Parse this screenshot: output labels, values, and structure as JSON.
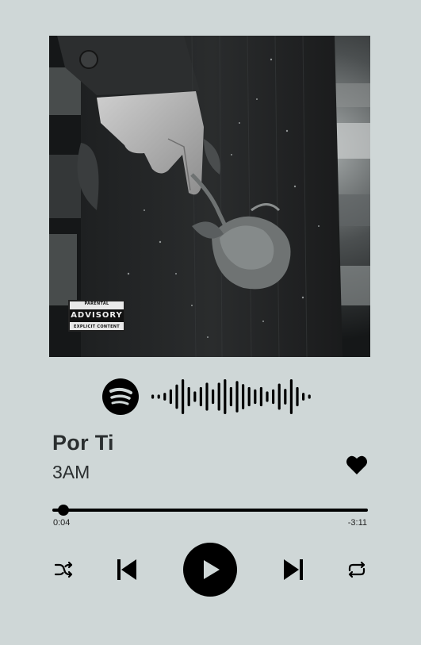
{
  "album": {
    "advisory_top": "PARENTAL",
    "advisory_main": "ADVISORY",
    "advisory_bottom": "EXPLICIT CONTENT"
  },
  "spotify_code": {
    "logo_icon": "spotify-logo-icon",
    "bar_levels": [
      0.12,
      0.12,
      0.22,
      0.42,
      0.7,
      1.0,
      0.55,
      0.3,
      0.55,
      0.8,
      0.42,
      0.8,
      1.0,
      0.55,
      0.9,
      0.72,
      0.55,
      0.42,
      0.55,
      0.3,
      0.42,
      0.75,
      0.45,
      1.0,
      0.55,
      0.22,
      0.12
    ]
  },
  "track": {
    "title": "Por Ti",
    "artist": "3AM",
    "liked": true
  },
  "playback": {
    "elapsed": "0:04",
    "remaining": "-3:11",
    "progress_fraction": 0.035
  },
  "controls": {
    "shuffle_icon": "shuffle-icon",
    "previous_icon": "skip-previous-icon",
    "play_icon": "play-icon",
    "next_icon": "skip-next-icon",
    "repeat_icon": "repeat-icon"
  },
  "colors": {
    "background": "#cfd7d7",
    "text": "#2b2f30",
    "controls": "#000000"
  }
}
